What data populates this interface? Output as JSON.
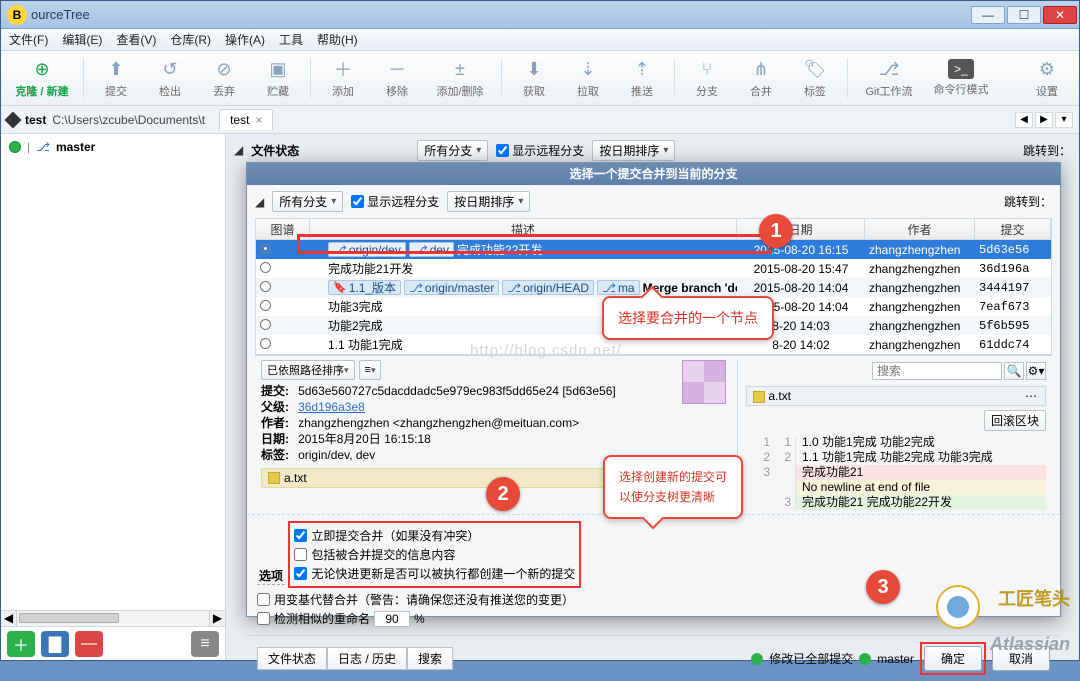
{
  "titlebar": {
    "badge": "B",
    "title": "ourceTree"
  },
  "menu": {
    "file": "文件(F)",
    "edit": "编辑(E)",
    "view": "查看(V)",
    "repo": "仓库(R)",
    "action": "操作(A)",
    "tool": "工具",
    "help": "帮助(H)"
  },
  "toolbar": {
    "clone": "克隆 / 新建",
    "commit": "提交",
    "checkout": "检出",
    "discard": "丢弃",
    "stash": "贮藏",
    "add": "添加",
    "remove": "移除",
    "addremove": "添加/删除",
    "fetch": "获取",
    "pull": "拉取",
    "push": "推送",
    "branch": "分支",
    "merge": "合并",
    "tag": "标签",
    "gitflow": "Git工作流",
    "cmd": "命令行模式",
    "settings": "设置"
  },
  "breadcrumb": {
    "repo": "test",
    "path": "C:\\Users\\zcube\\Documents\\t"
  },
  "tab": {
    "name": "test"
  },
  "sidebar": {
    "branch_label": "master"
  },
  "under": {
    "filestatus": "文件状态",
    "allbranch": "所有分支",
    "showremote": "显示远程分支",
    "datesort": "按日期排序",
    "jump": "跳转到："
  },
  "modal": {
    "title": "选择一个提交合并到当前的分支",
    "filters": {
      "allbranch": "所有分支",
      "showremote": "显示远程分支",
      "datesort": "按日期排序",
      "jump": "跳转到："
    },
    "cols": {
      "graph": "图谱",
      "desc": "描述",
      "date": "日期",
      "author": "作者",
      "commit": "提交"
    }
  },
  "rows": [
    {
      "tags": [
        "origin/dev",
        "dev"
      ],
      "desc": "完成功能22开发",
      "date": "2015-08-20 16:15",
      "author": "zhangzhengzhen",
      "commit": "5d63e56",
      "sel": true
    },
    {
      "tags": [],
      "desc": "完成功能21开发",
      "date": "2015-08-20 15:47",
      "author": "zhangzhengzhen",
      "commit": "36d196a"
    },
    {
      "tags": [
        "1.1_版本",
        "origin/master",
        "origin/HEAD",
        "ma"
      ],
      "desc": "Merge branch 'dev'",
      "date": "2015-08-20 14:04",
      "author": "zhangzhengzhen",
      "commit": "3444197",
      "bold": true
    },
    {
      "tags": [],
      "desc": "功能3完成",
      "date": "2015-08-20 14:04",
      "author": "zhangzhengzhen",
      "commit": "7eaf673"
    },
    {
      "tags": [],
      "desc": "功能2完成",
      "date": "8-20 14:03",
      "author": "zhangzhengzhen",
      "commit": "5f6b595"
    },
    {
      "tags": [],
      "desc": "1.1 功能1完成",
      "date": "8-20 14:02",
      "author": "zhangzhengzhen",
      "commit": "61ddc74"
    }
  ],
  "detail": {
    "pathsort": "已依照路径排序",
    "hamburger": "≡",
    "k_commit": "提交:",
    "v_commit": "5d63e560727c5dacddadc5e979ec983f5dd65e24 [5d63e56]",
    "k_parent": "父级:",
    "v_parent": "36d196a3e8",
    "k_author": "作者:",
    "v_author": "zhangzhengzhen <zhangzhengzhen@meituan.com>",
    "k_date": "日期:",
    "v_date": "2015年8月20日 16:15:18",
    "k_label": "标签:",
    "v_label": "origin/dev, dev",
    "file": "a.txt"
  },
  "diff": {
    "file": "a.txt",
    "search_ph": "搜索",
    "revert": "回滚区块",
    "l1": "1.0 功能1完成 功能2完成",
    "l2": "1.1 功能1完成 功能2完成 功能3完成",
    "l3": "完成功能21",
    "nnl": "No newline at end of file",
    "l4": "完成功能21 完成功能22开发"
  },
  "options": {
    "title": "选项",
    "o1": "立即提交合并（如果没有冲突）",
    "o2": "包括被合并提交的信息内容",
    "o3": "无论快进更新是否可以被执行都创建一个新的提交",
    "o4": "用变基代替合并（警告：请确保您还没有推送您的变更）",
    "o5": "检测相似的重命名",
    "pct": "90",
    "pct_suffix": "%"
  },
  "footer": {
    "tab_file": "文件状态",
    "tab_log": "日志 / 历史",
    "tab_search": "搜索",
    "status": "修改已全部提交",
    "branch": "master",
    "ok": "确定",
    "cancel": "取消"
  },
  "callout1": "选择要合并的一个节点",
  "callout2a": "选择创建新的提交可",
  "callout2b": "以使分支树更清晰",
  "watermark_blog": "http://blog.csdn.net/",
  "watermark_txt": "工匠笔头",
  "atlassian": "Atlassian"
}
